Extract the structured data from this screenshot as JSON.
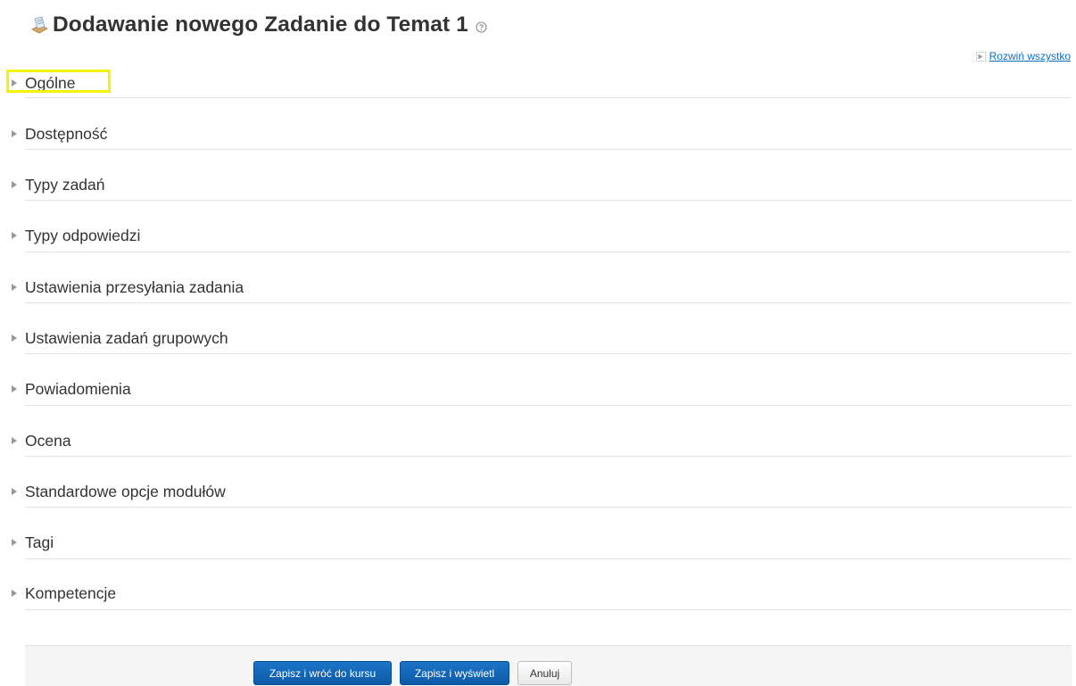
{
  "header": {
    "title": "Dodawanie nowego Zadanie do Temat 1",
    "icon": "assignment-icon",
    "help_icon": "help-icon"
  },
  "expand_all": {
    "label": "Rozwiń wszystko"
  },
  "sections": [
    {
      "label": "Ogólne",
      "highlighted": true
    },
    {
      "label": "Dostępność"
    },
    {
      "label": "Typy zadań"
    },
    {
      "label": "Typy odpowiedzi"
    },
    {
      "label": "Ustawienia przesyłania zadania"
    },
    {
      "label": "Ustawienia zadań grupowych"
    },
    {
      "label": "Powiadomienia"
    },
    {
      "label": "Ocena"
    },
    {
      "label": "Standardowe opcje modułów"
    },
    {
      "label": "Tagi"
    },
    {
      "label": "Kompetencje"
    }
  ],
  "buttons": {
    "save_return": "Zapisz i wróć do kursu",
    "save_display": "Zapisz i wyświetl",
    "cancel": "Anuluj"
  },
  "colors": {
    "link": "#0f6fc5",
    "primary_button": "#0f6fc5",
    "highlight": "#f4f400",
    "divider": "#e3e3e3"
  }
}
